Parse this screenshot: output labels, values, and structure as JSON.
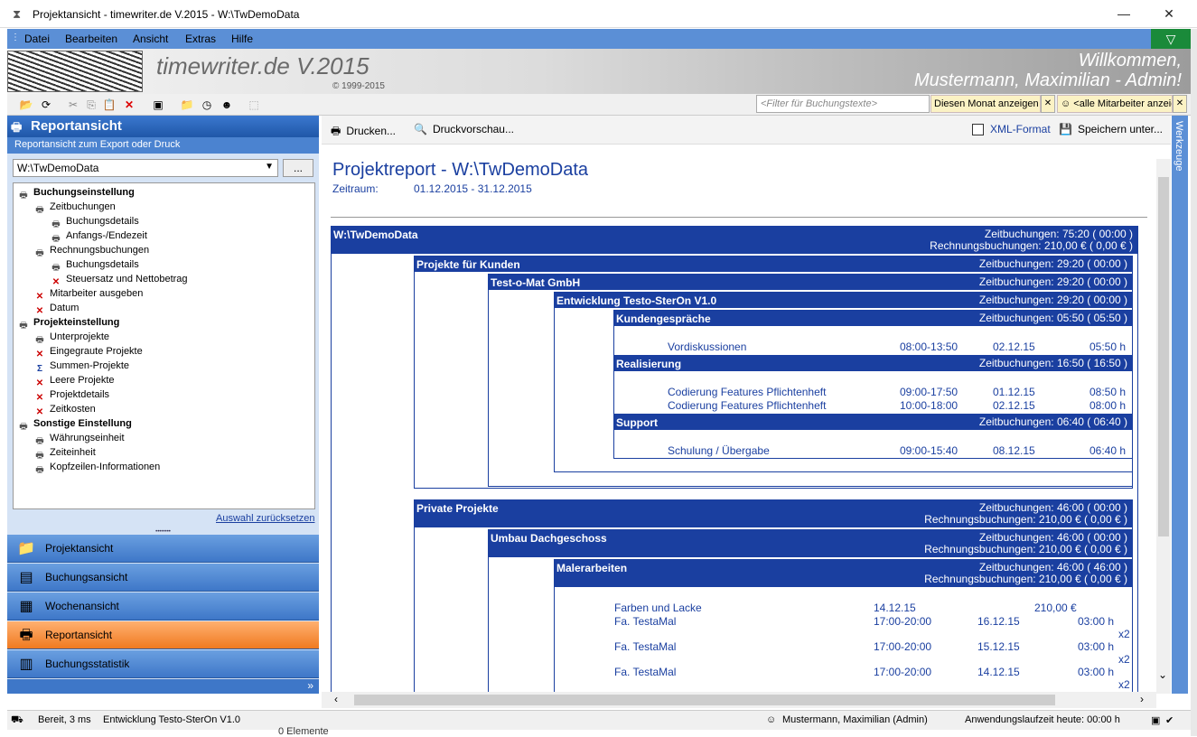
{
  "window": {
    "title": "Projektansicht - timewriter.de V.2015 - W:\\TwDemoData",
    "minimize": "—",
    "close": "✕"
  },
  "menu": [
    "Datei",
    "Bearbeiten",
    "Ansicht",
    "Extras",
    "Hilfe"
  ],
  "banner": {
    "brand": "timewriter.de V.2015",
    "copyright": "© 1999-2015",
    "welcome_line1": "Willkommen,",
    "welcome_line2": "Mustermann, Maximilian  - Admin!"
  },
  "toolbar": {
    "filter_placeholder": "<Filter für Buchungstexte>",
    "month": "Diesen Monat anzeigen",
    "users": "<alle Mitarbeiter anzeigen>"
  },
  "sidebar": {
    "title": "Reportansicht",
    "subtitle": "Reportansicht zum Export oder Druck",
    "combo_value": "W:\\TwDemoData",
    "ellipsis": "...",
    "reset": "Auswahl zurücksetzen",
    "tree": [
      {
        "label": "Buchungseinstellung",
        "level": 0,
        "icon": "p"
      },
      {
        "label": "Zeitbuchungen",
        "level": 1,
        "icon": "p"
      },
      {
        "label": "Buchungsdetails",
        "level": 2,
        "icon": "p"
      },
      {
        "label": "Anfangs-/Endezeit",
        "level": 2,
        "icon": "p"
      },
      {
        "label": "Rechnungsbuchungen",
        "level": 1,
        "icon": "p"
      },
      {
        "label": "Buchungsdetails",
        "level": 2,
        "icon": "p"
      },
      {
        "label": "Steuersatz und Nettobetrag",
        "level": 2,
        "icon": "x"
      },
      {
        "label": "Mitarbeiter ausgeben",
        "level": 1,
        "icon": "x"
      },
      {
        "label": "Datum",
        "level": 1,
        "icon": "x"
      },
      {
        "label": "Projekteinstellung",
        "level": 0,
        "icon": "p"
      },
      {
        "label": "Unterprojekte",
        "level": 1,
        "icon": "p"
      },
      {
        "label": "Eingegraute Projekte",
        "level": 1,
        "icon": "x"
      },
      {
        "label": "Summen-Projekte",
        "level": 1,
        "icon": "s"
      },
      {
        "label": "Leere Projekte",
        "level": 1,
        "icon": "x"
      },
      {
        "label": "Projektdetails",
        "level": 1,
        "icon": "x"
      },
      {
        "label": "Zeitkosten",
        "level": 1,
        "icon": "x"
      },
      {
        "label": "Sonstige Einstellung",
        "level": 0,
        "icon": "p"
      },
      {
        "label": "Währungseinheit",
        "level": 1,
        "icon": "p"
      },
      {
        "label": "Zeiteinheit",
        "level": 1,
        "icon": "p"
      },
      {
        "label": "Kopfzeilen-Informationen",
        "level": 1,
        "icon": "p"
      }
    ],
    "nav": [
      {
        "label": "Projektansicht",
        "icon": "folder-icon",
        "glyph": "📁",
        "active": false
      },
      {
        "label": "Buchungsansicht",
        "icon": "booking-icon",
        "glyph": "▤",
        "active": false
      },
      {
        "label": "Wochenansicht",
        "icon": "calendar-icon",
        "glyph": "▦",
        "active": false
      },
      {
        "label": "Reportansicht",
        "icon": "printer-icon",
        "glyph": "🖶",
        "active": true
      },
      {
        "label": "Buchungsstatistik",
        "icon": "statistics-icon",
        "glyph": "▥",
        "active": false
      }
    ],
    "more": "»"
  },
  "content_toolbar": {
    "print": "Drucken...",
    "preview": "Druckvorschau...",
    "xml": "XML-Format",
    "save": "Speichern unter..."
  },
  "report": {
    "title": "Projektreport - W:\\TwDemoData",
    "range_label": "Zeitraum:",
    "range_value": "01.12.2015 - 31.12.2015",
    "root": {
      "name": "W:\\TwDemoData",
      "line1": "Zeitbuchungen: 75:20 ( 00:00 )",
      "line2": "Rechnungsbuchungen: 210,00 € ( 0,00 € )"
    },
    "kunden": {
      "name": "Projekte für Kunden",
      "line1": "Zeitbuchungen: 29:20 ( 00:00 )"
    },
    "testomat": {
      "name": "Test-o-Mat GmbH",
      "line1": "Zeitbuchungen: 29:20 ( 00:00 )"
    },
    "entwicklung": {
      "name": "Entwicklung Testo-SterOn V1.0",
      "line1": "Zeitbuchungen: 29:20 ( 00:00 )"
    },
    "kundengespraeche": {
      "name": "Kundengespräche",
      "line1": "Zeitbuchungen: 05:50 ( 05:50 )"
    },
    "kg_rows": [
      {
        "text": "Vordiskussionen",
        "time": "08:00-13:50",
        "date": "02.12.15",
        "dur": "05:50 h"
      }
    ],
    "realisierung": {
      "name": "Realisierung",
      "line1": "Zeitbuchungen: 16:50 ( 16:50 )"
    },
    "re_rows": [
      {
        "text": "Codierung Features Pflichtenheft",
        "time": "09:00-17:50",
        "date": "01.12.15",
        "dur": "08:50 h"
      },
      {
        "text": "Codierung Features Pflichtenheft",
        "time": "10:00-18:00",
        "date": "02.12.15",
        "dur": "08:00 h"
      }
    ],
    "support": {
      "name": "Support",
      "line1": "Zeitbuchungen: 06:40 ( 06:40 )"
    },
    "su_rows": [
      {
        "text": "Schulung / Übergabe",
        "time": "09:00-15:40",
        "date": "08.12.15",
        "dur": "06:40 h"
      }
    ],
    "privat": {
      "name": "Private Projekte",
      "line1": "Zeitbuchungen: 46:00 ( 00:00 )",
      "line2": "Rechnungsbuchungen: 210,00 € ( 0,00 € )"
    },
    "umbau": {
      "name": "Umbau Dachgeschoss",
      "line1": "Zeitbuchungen: 46:00 ( 00:00 )",
      "line2": "Rechnungsbuchungen: 210,00 € ( 0,00 € )"
    },
    "maler": {
      "name": "Malerarbeiten",
      "line1": "Zeitbuchungen: 46:00 ( 46:00 )",
      "line2": "Rechnungsbuchungen: 210,00 € ( 0,00 € )"
    },
    "ma_invoice": {
      "text": "Farben und Lacke",
      "date": "14.12.15",
      "amount": "210,00 €"
    },
    "ma_rows": [
      {
        "text": "Fa. TestaMal",
        "time": "17:00-20:00",
        "date": "16.12.15",
        "dur": "03:00 h",
        "mult": "x2"
      },
      {
        "text": "Fa. TestaMal",
        "time": "17:00-20:00",
        "date": "15.12.15",
        "dur": "03:00 h",
        "mult": "x2"
      },
      {
        "text": "Fa. TestaMal",
        "time": "17:00-20:00",
        "date": "14.12.15",
        "dur": "03:00 h",
        "mult": "x2"
      }
    ]
  },
  "side_tab": "Werkzeuge",
  "status": {
    "ready": "Bereit, 3 ms",
    "project": "Entwicklung Testo-SterOn V1.0",
    "user": "Mustermann, Maximilian  (Admin)",
    "runtime": "Anwendungslaufzeit heute: 00:00 h",
    "elements": "0 Elemente"
  }
}
